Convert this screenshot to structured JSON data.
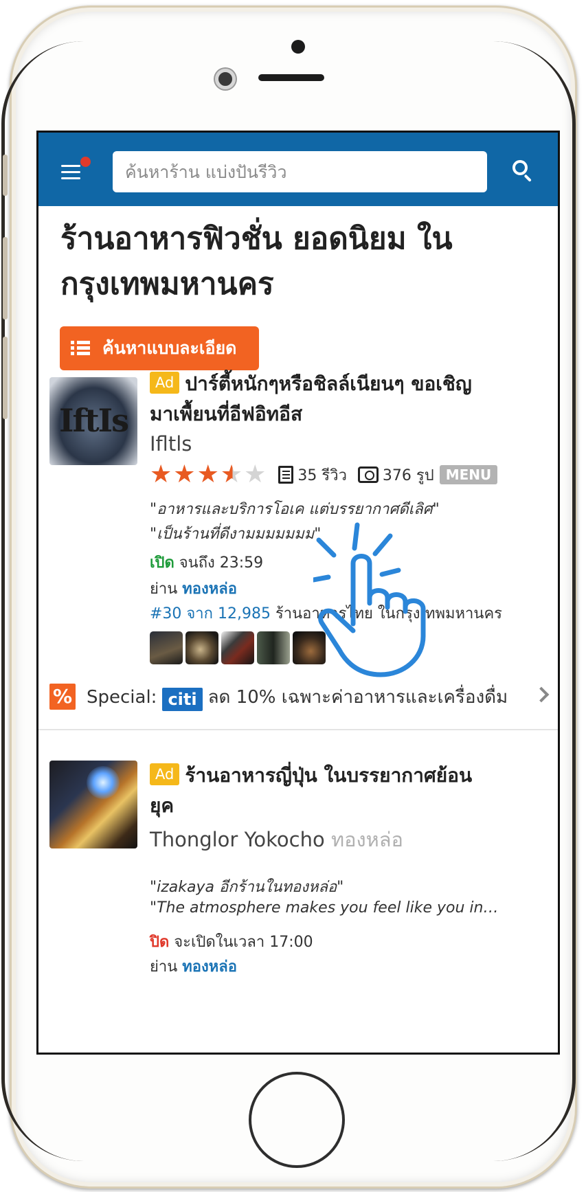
{
  "search": {
    "placeholder": "ค้นหาร้าน แบ่งปันรีวิว"
  },
  "page_title": "ร้านอาหารฟิวชั่น ยอดนิยม ในกรุงเทพมหานคร",
  "filter_button": {
    "label": "ค้นหาแบบละเอียด"
  },
  "listings": [
    {
      "ad_label": "Ad",
      "title": "ปาร์ตี้หนักๆหรือชิลล์เนียนๆ ขอเชิญมาเพื้ยนที่อีฟอิทอีส",
      "name": "Ifltls",
      "thumbnail_text": "IftIs",
      "rating_stars": 3.5,
      "reviews": "35 รีวิว",
      "photos": "376 รูป",
      "menu_badge": "MENU",
      "quotes": [
        "\"อาหารและบริการโอเค แต่บรรยากาศดีเลิศ\"",
        "\"เป็นร้านที่ดีงามมมมมมม\""
      ],
      "status": "เปิด",
      "status_detail": "จนถึง 23:59",
      "area_label": "ย่าน",
      "area": "ทองหล่อ",
      "rank": "#30 จาก 12,985",
      "rank_detail": "ร้านอาหารไทย ในกรุงเทพมหานคร",
      "special": {
        "prefix": "Special:",
        "bank": "citi",
        "text": "ลด 10% เฉพาะค่าอาหารและเครื่องดื่ม"
      }
    },
    {
      "ad_label": "Ad",
      "title": "ร้านอาหารญี่ปุ่น ในบรรยากาศย้อนยุค",
      "name": "Thonglor Yokocho",
      "area_inline": "ทองหล่อ",
      "quotes": [
        "\"izakaya อีกร้านในทองหล่อ\"",
        "\"The atmosphere makes you feel like you in…"
      ],
      "status": "ปิด",
      "status_detail": "จะเปิดในเวลา 17:00",
      "area_label": "ย่าน",
      "area": "ทองหล่อ"
    }
  ],
  "colors": {
    "header": "#1067a6",
    "accent_orange": "#f26322",
    "ad_yellow": "#f5b81a",
    "star": "#e85a22",
    "open_green": "#1e9b3a",
    "closed_red": "#e0382a",
    "link_blue": "#1a73b5",
    "gesture_blue": "#2b86d9"
  }
}
